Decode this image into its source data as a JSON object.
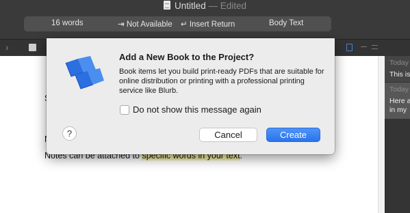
{
  "window": {
    "title": "Untitled",
    "status": "— Edited"
  },
  "stats_bar": {
    "word_count": "16 words",
    "tab_action": "⇥ Not Available",
    "return_action": "↵ Insert Return",
    "style": "Body Text"
  },
  "editor": {
    "fragment_1": "S",
    "fragment_2": "N",
    "notes_before": "Notes can be attached to ",
    "notes_highlight": "specific words in your text",
    "notes_after": "."
  },
  "comments": [
    {
      "date": "Today",
      "lines": [
        "This is"
      ]
    },
    {
      "date": "Today",
      "lines": [
        "Here a",
        "in my"
      ]
    }
  ],
  "dialog": {
    "title": "Add a New Book to the Project?",
    "message": "Book items let you build print-ready PDFs that are suitable for online distribution or printing with a professional printing service like Blurb.",
    "checkbox_label": "Do not show this message again",
    "checkbox_checked": false,
    "help_label": "?",
    "cancel_label": "Cancel",
    "create_label": "Create",
    "icon": "book-icon"
  },
  "colors": {
    "accent": "#2f7bf5",
    "highlight": "#f7f2a8",
    "book_blue": "#2b6fe0"
  }
}
